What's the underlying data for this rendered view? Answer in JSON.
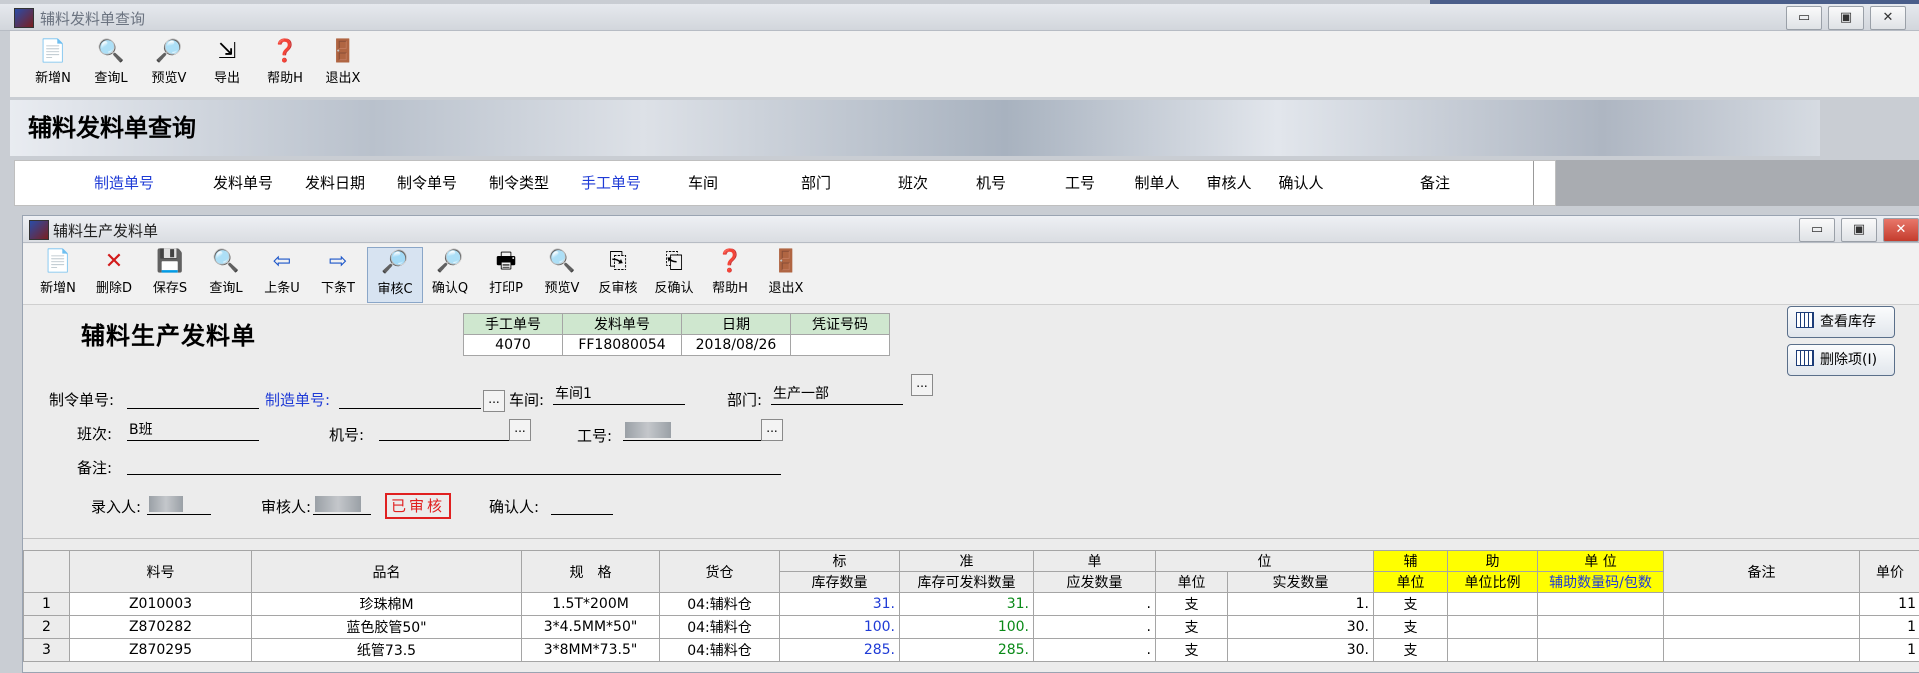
{
  "outer_window": {
    "title": "辅料发料单查询",
    "toolbar": [
      "新增N",
      "查询L",
      "预览V",
      "导出",
      "帮助H",
      "退出X"
    ],
    "banner_title": "辅料发料单查询",
    "columns": [
      "制造单号",
      "发料单号",
      "发料日期",
      "制令单号",
      "制令类型",
      "手工单号",
      "车间",
      "部门",
      "班次",
      "机号",
      "工号",
      "制单人",
      "审核人",
      "确认人",
      "备注"
    ]
  },
  "inner_window": {
    "title": "辅料生产发料单",
    "toolbar": [
      "新增N",
      "删除D",
      "保存S",
      "查询L",
      "上条U",
      "下条T",
      "审核C",
      "确认Q",
      "打印P",
      "预览V",
      "反审核",
      "反确认",
      "帮助H",
      "退出X"
    ],
    "form_title": "辅料生产发料单",
    "info_table": {
      "headers": [
        "手工单号",
        "发料单号",
        "日期",
        "凭证号码"
      ],
      "values": [
        "4070",
        "FF18080054",
        "2018/08/26",
        ""
      ]
    },
    "side_buttons": [
      "查看库存",
      "删除项(I)"
    ],
    "fields": {
      "order_label": "制令单号:",
      "order_value": "",
      "mfg_label": "制造单号:",
      "mfg_value": "",
      "workshop_label": "车间:",
      "workshop_value": "车间1",
      "dept_label": "部门:",
      "dept_value": "生产一部",
      "shift_label": "班次:",
      "shift_value": "B班",
      "machine_label": "机号:",
      "machine_value": "",
      "worker_label": "工号:",
      "note_label": "备注:",
      "note_value": "",
      "entry_label": "录入人:",
      "auditor_label": "审核人:",
      "audit_status": "已审核",
      "confirmer_label": "确认人:",
      "confirmer_value": ""
    },
    "grid": {
      "group_std": [
        "标",
        "准",
        "单",
        "位"
      ],
      "group_aux": [
        "辅",
        "助",
        "单 位"
      ],
      "headers": [
        "料号",
        "品名",
        "规　格",
        "货仓",
        "库存数量",
        "库存可发料数量",
        "应发数量",
        "单位",
        "实发数量",
        "单位",
        "单位比例",
        "辅助数量码/包数",
        "备注",
        "单价"
      ],
      "rows": [
        {
          "idx": "1",
          "code": "Z010003",
          "name": "珍珠棉M",
          "spec": "1.5T*200M",
          "wh": "04:辅料仓",
          "stock": "31.",
          "avail": "31.",
          "due": ".",
          "unit": "支",
          "actual": "1.",
          "aux_unit": "支",
          "ratio": "",
          "aux_qty": "",
          "note": "",
          "price": "11"
        },
        {
          "idx": "2",
          "code": "Z870282",
          "name": "蓝色胶管50\"",
          "spec": "3*4.5MM*50\"",
          "wh": "04:辅料仓",
          "stock": "100.",
          "avail": "100.",
          "due": ".",
          "unit": "支",
          "actual": "30.",
          "aux_unit": "支",
          "ratio": "",
          "aux_qty": "",
          "note": "",
          "price": "1"
        },
        {
          "idx": "3",
          "code": "Z870295",
          "name": "纸管73.5",
          "spec": "3*8MM*73.5\"",
          "wh": "04:辅料仓",
          "stock": "285.",
          "avail": "285.",
          "due": ".",
          "unit": "支",
          "actual": "30.",
          "aux_unit": "支",
          "ratio": "",
          "aux_qty": "",
          "note": "",
          "price": "1"
        }
      ]
    }
  }
}
